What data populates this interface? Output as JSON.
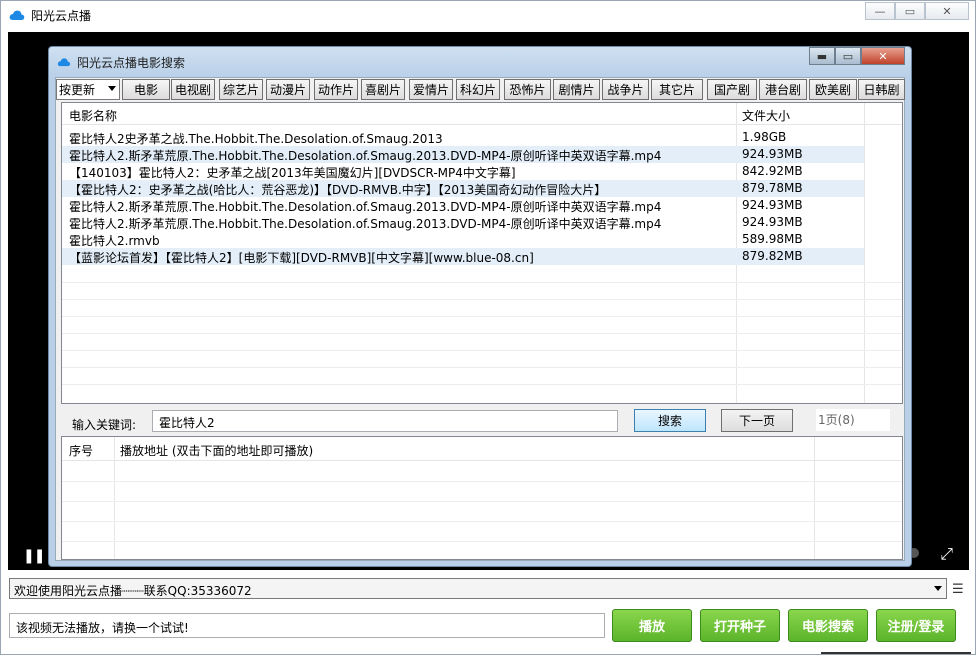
{
  "window": {
    "title": "阳光云点播",
    "minimize_glyph": "—",
    "restore_glyph": "▭",
    "close_glyph": "✕"
  },
  "player": {
    "pause_glyph": "❚❚",
    "fullscreen_glyph": "⤢"
  },
  "dialog": {
    "title": "阳光云点播电影搜索",
    "minimize_glyph": "▬",
    "maximize_glyph": "▭",
    "close_glyph": "✕",
    "sort_select": "按更新",
    "categories": [
      "电影",
      "电视剧",
      "综艺片",
      "动漫片",
      "动作片",
      "喜剧片",
      "爱情片",
      "科幻片",
      "恐怖片",
      "剧情片",
      "战争片",
      "其它片",
      "国产剧",
      "港台剧",
      "欧美剧",
      "日韩剧"
    ],
    "results": {
      "col_name": "电影名称",
      "col_size": "文件大小",
      "rows": [
        {
          "name": "霍比特人2史矛革之战.The.Hobbit.The.Desolation.of.Smaug.2013",
          "size": "1.98GB"
        },
        {
          "name": "霍比特人2.斯矛革荒原.The.Hobbit.The.Desolation.of.Smaug.2013.DVD-MP4-原创听译中英双语字幕.mp4",
          "size": "924.93MB"
        },
        {
          "name": "【140103】霍比特人2：史矛革之战[2013年美国魔幻片][DVDSCR-MP4中文字幕]",
          "size": "842.92MB"
        },
        {
          "name": "【霍比特人2：史矛革之战(哈比人：荒谷恶龙)】【DVD-RMVB.中字】【2013美国奇幻动作冒险大片】",
          "size": "879.78MB"
        },
        {
          "name": "霍比特人2.斯矛革荒原.The.Hobbit.The.Desolation.of.Smaug.2013.DVD-MP4-原创听译中英双语字幕.mp4",
          "size": "924.93MB"
        },
        {
          "name": "霍比特人2.斯矛革荒原.The.Hobbit.The.Desolation.of.Smaug.2013.DVD-MP4-原创听译中英双语字幕.mp4",
          "size": "924.93MB"
        },
        {
          "name": "霍比特人2.rmvb",
          "size": "589.98MB"
        },
        {
          "name": "【蓝影论坛首发】【霍比特人2】[电影下载][DVD-RMVB][中文字幕][www.blue-08.cn]",
          "size": "879.82MB"
        }
      ]
    },
    "keyword_label": "输入关键词:",
    "keyword_value": "霍比特人2",
    "search_button": "搜索",
    "next_page_button": "下一页",
    "page_info": "1页(8)",
    "playlist": {
      "col_index": "序号",
      "col_url": "播放地址 (双击下面的地址即可播放)"
    }
  },
  "bottom": {
    "status_text": "欢迎使用阳光云点播┈┈┈联系QQ:35336072",
    "message_text": "该视频无法播放，请换一个试试!",
    "buttons": {
      "play": "播放",
      "open_seed": "打开种子",
      "movie_search": "电影搜索",
      "register_login": "注册/登录"
    }
  },
  "colors": {
    "accent_blue": "#3c7fb1",
    "green_button": "#5bb42a",
    "row_highlight": "#e3eef9"
  }
}
